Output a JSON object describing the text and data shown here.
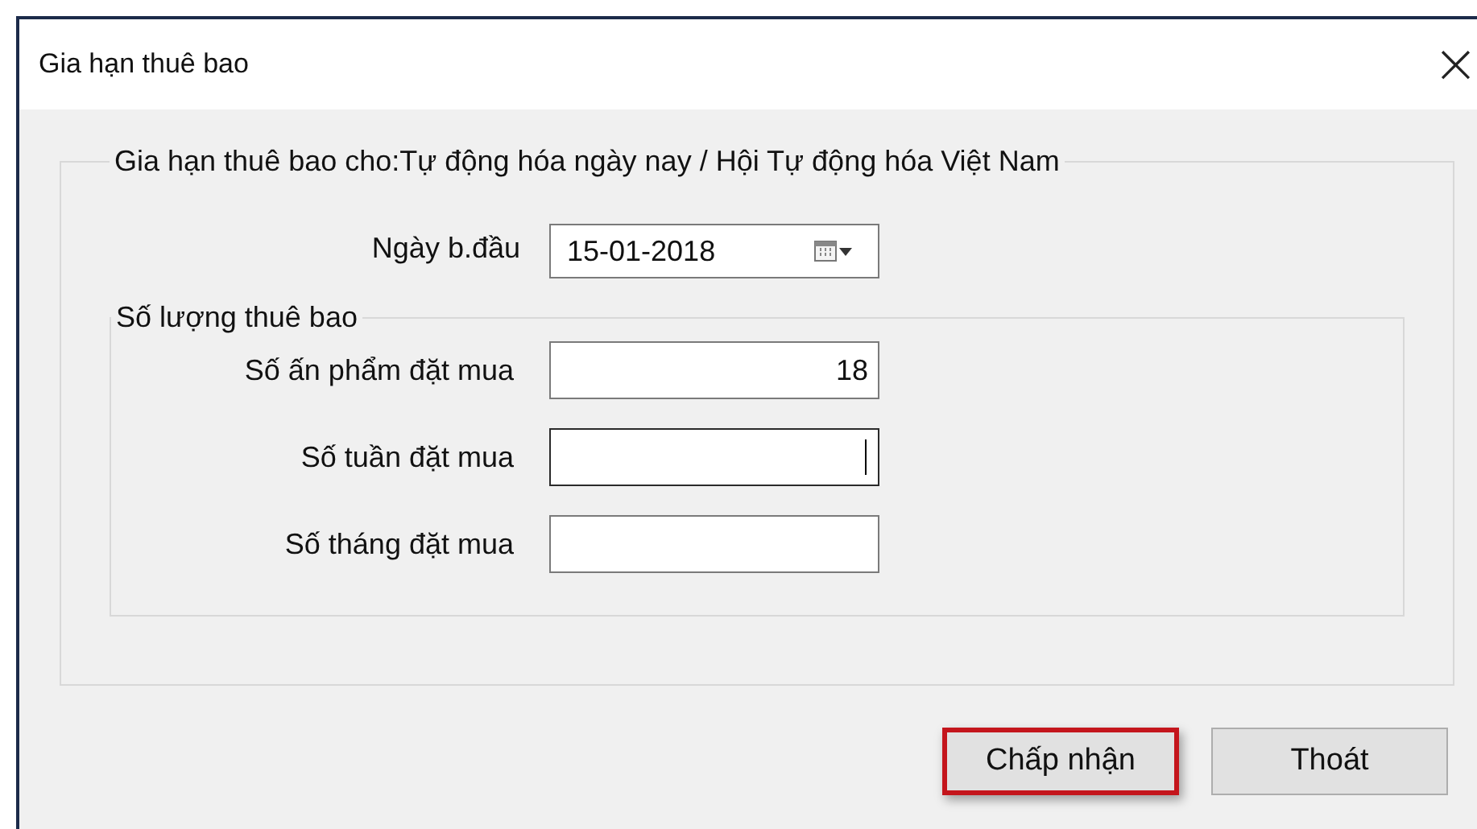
{
  "window": {
    "title": "Gia hạn thuê bao",
    "close": "×"
  },
  "group": {
    "legend": "Gia hạn thuê bao cho:Tự động hóa ngày nay /  Hội Tự động hóa Việt Nam",
    "start_date": {
      "label": "Ngày b.đầu",
      "value": "15-01-2018"
    },
    "quantity": {
      "legend": "Số lượng thuê bao",
      "fields": [
        {
          "label": "Số ấn phẩm đặt mua",
          "value": "18",
          "focused": false
        },
        {
          "label": "Số tuần đặt mua",
          "focused": true
        },
        {
          "label": "Số tháng đặt mua",
          "focused": false
        }
      ]
    }
  },
  "buttons": [
    {
      "label": "Chấp nhận",
      "highlighted": true
    },
    {
      "label": "Thoát",
      "highlighted": false
    }
  ]
}
